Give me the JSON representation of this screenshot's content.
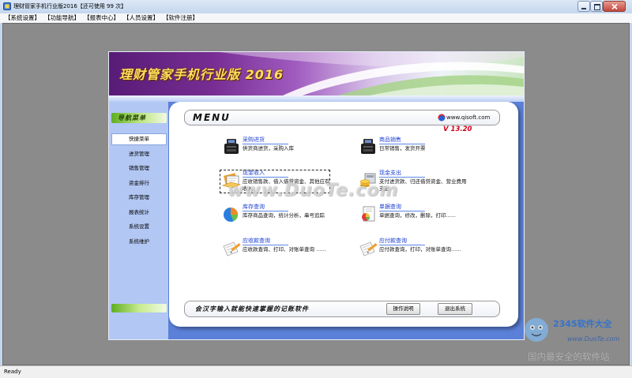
{
  "window": {
    "title": "理财管家手机行业版2016【还可使用 99 次】"
  },
  "menu_bar": {
    "items": [
      "【系统设置】",
      "【功能导航】",
      "【报表中心】",
      "【人员设置】",
      "【软件注册】"
    ]
  },
  "banner": {
    "title": "理财管家手机行业版 2016"
  },
  "sidebar": {
    "header": "导航菜单",
    "selected": "快捷菜单",
    "items": [
      "快捷菜单",
      "进货管理",
      "销售管理",
      "资金排行",
      "库存管理",
      "报表统计",
      "系统设置",
      "系统维护"
    ]
  },
  "panel": {
    "heading": "MENU",
    "website": "www.qisoft.com",
    "version": "V 13.20",
    "items": [
      {
        "title": "采购进货",
        "desc": "供货商进货，采购入库",
        "icon": "cash-register-icon"
      },
      {
        "title": "商品销售",
        "desc": "日常销售，发货开票",
        "icon": "cash-register-icon"
      },
      {
        "title": "现金收入",
        "desc": "应收销售款、借入借贷资金、其他应有收入",
        "icon": "cash-income-icon"
      },
      {
        "title": "现金支出",
        "desc": "支付进货款、归还借贷资金、营业费用支出",
        "icon": "cash-expense-icon"
      },
      {
        "title": "库存查询",
        "desc": "库存商品查询，统计分析，串号追踪",
        "icon": "pie-chart-icon"
      },
      {
        "title": "单据查询",
        "desc": "单据查询，修改，删除，打印......",
        "icon": "bill-chart-icon"
      },
      {
        "title": "应收款查询",
        "desc": "应收款查询、打印、对账单查询 ......",
        "icon": "document-pencil-icon"
      },
      {
        "title": "应付款查询",
        "desc": "应付款查询，打印，对账单查询......",
        "icon": "document-pencil-icon"
      }
    ]
  },
  "footer": {
    "slogan": "会汉字输入就能快速掌握的记账软件",
    "help_button": "操作说明",
    "exit_button": "退出系统"
  },
  "status_bar": {
    "text": "Ready"
  },
  "watermarks": {
    "center": "www.DuoTe.com",
    "brand": "2345软件大全",
    "site": "www.DuoTe.com",
    "tagline": "国内最安全的软件站"
  },
  "colors": {
    "client_background": "#8b8b8b",
    "panel_blue": "#5b80d8",
    "banner_purple": "#772d93",
    "banner_title": "#ffdf5e",
    "item_title_blue": "#1d3fd0",
    "version_red": "#d0021b",
    "close_button_red": "#c4463b"
  }
}
